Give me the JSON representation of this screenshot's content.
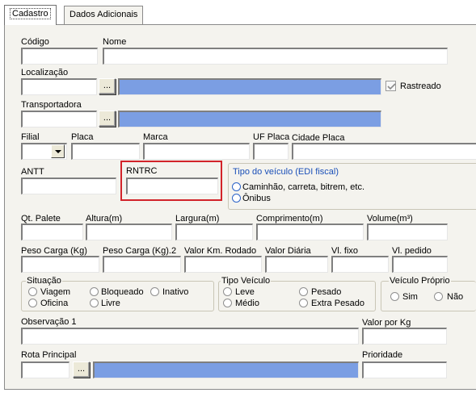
{
  "tabs": [
    {
      "label": "Cadastro",
      "active": true
    },
    {
      "label": "Dados Adicionais",
      "active": false
    }
  ],
  "fields": {
    "codigo": {
      "label": "Código",
      "value": ""
    },
    "nome": {
      "label": "Nome",
      "value": ""
    },
    "localizacao": {
      "label": "Localização",
      "value": ""
    },
    "rastreado": {
      "label": "Rastreado",
      "checked": true
    },
    "transportadora": {
      "label": "Transportadora",
      "value": ""
    },
    "filial": {
      "label": "Filial",
      "value": ""
    },
    "placa": {
      "label": "Placa",
      "value": ""
    },
    "marca": {
      "label": "Marca",
      "value": ""
    },
    "uf_placa": {
      "label": "UF Placa",
      "value": ""
    },
    "cidade_placa": {
      "label": "Cidade Placa",
      "value": ""
    },
    "antt": {
      "label": "ANTT",
      "value": ""
    },
    "rntrc": {
      "label": "RNTRC",
      "value": ""
    },
    "qt_palete": {
      "label": "Qt. Palete",
      "value": ""
    },
    "altura": {
      "label": "Altura(m)",
      "value": ""
    },
    "largura": {
      "label": "Largura(m)",
      "value": ""
    },
    "comprimento": {
      "label": "Comprimento(m)",
      "value": ""
    },
    "volume": {
      "label": "Volume(m³)",
      "value": ""
    },
    "peso_carga": {
      "label": "Peso Carga (Kg)",
      "value": ""
    },
    "peso_carga2": {
      "label": "Peso Carga (Kg).2",
      "value": ""
    },
    "valor_km": {
      "label": "Valor Km. Rodado",
      "value": ""
    },
    "valor_diaria": {
      "label": "Valor Diária",
      "value": ""
    },
    "vl_fixo": {
      "label": "Vl. fixo",
      "value": ""
    },
    "vl_pedido": {
      "label": "Vl. pedido",
      "value": ""
    },
    "observacao1": {
      "label": "Observação 1",
      "value": ""
    },
    "valor_por_kg": {
      "label": "Valor por Kg",
      "value": ""
    },
    "rota_principal": {
      "label": "Rota Principal",
      "value": ""
    },
    "prioridade": {
      "label": "Prioridade",
      "value": ""
    }
  },
  "ellipsis_label": "...",
  "tipo_veiculo_edi": {
    "title": "Tipo do veículo (EDI fiscal)",
    "options": [
      "Caminhão, carreta, bitrem, etc.",
      "Ônibus"
    ]
  },
  "situacao": {
    "title": "Situação",
    "options": [
      "Viagem",
      "Bloqueado",
      "Inativo",
      "Oficina",
      "Livre"
    ]
  },
  "tipo_veiculo": {
    "title": "Tipo  Veículo",
    "options": [
      "Leve",
      "Pesado",
      "Médio",
      "Extra Pesado"
    ]
  },
  "veiculo_proprio": {
    "title": "Veículo Próprio",
    "options": [
      "Sim",
      "Não"
    ]
  },
  "colors": {
    "panel_bg": "#f4f3ee",
    "lookup_fill": "#7b9ee3",
    "highlight_border": "#d2232a",
    "group_title_blue": "#1a4fb8"
  }
}
